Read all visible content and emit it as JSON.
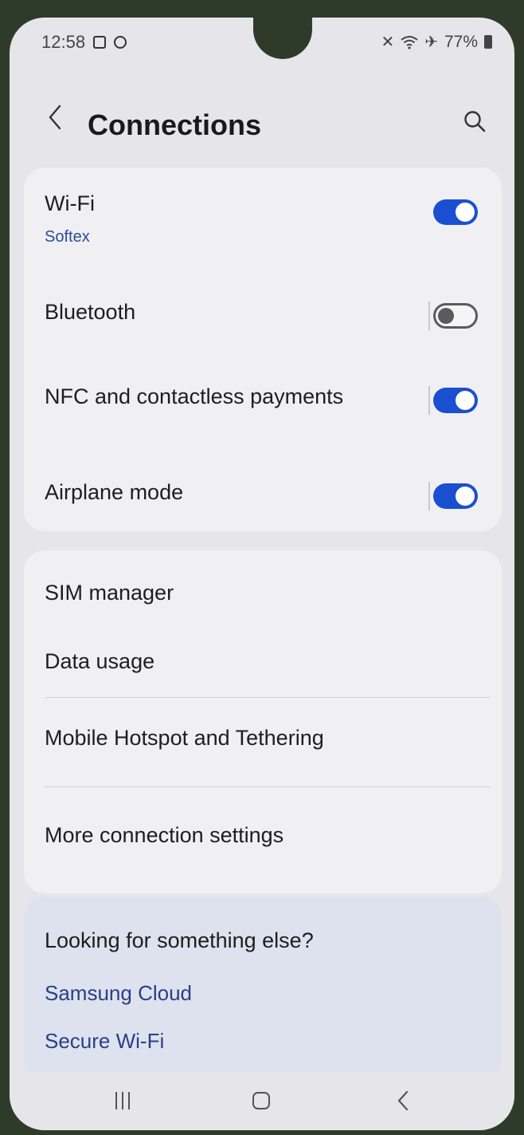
{
  "status_bar": {
    "time": "12:58",
    "battery": "77%",
    "left_icons": [
      "gallery-icon",
      "sync-icon"
    ],
    "right_icons": [
      "mute-icon",
      "wifi-icon",
      "airplane-icon",
      "battery-icon"
    ]
  },
  "header": {
    "title": "Connections",
    "back_icon": "chevron-left-icon",
    "search_icon": "search-icon"
  },
  "settings": {
    "wifi": {
      "label": "Wi-Fi",
      "network": "Softex",
      "enabled": true
    },
    "bluetooth": {
      "label": "Bluetooth",
      "enabled": false
    },
    "nfc": {
      "label": "NFC and contactless payments",
      "enabled": true
    },
    "airplane": {
      "label": "Airplane mode",
      "enabled": true
    },
    "items": [
      "SIM manager",
      "Data usage",
      "Mobile Hotspot and Tethering",
      "More connection settings"
    ]
  },
  "suggestions": {
    "title": "Looking for something else?",
    "links": [
      "Samsung Cloud",
      "Secure Wi-Fi"
    ]
  },
  "nav_bar": {
    "recents_icon": "recents-icon",
    "home_icon": "home-icon",
    "back_icon": "back-icon"
  },
  "colors": {
    "accent": "#1b4fd2",
    "link": "#2b3f86",
    "card": "#f0f0f3",
    "background": "#e6e6ea"
  }
}
